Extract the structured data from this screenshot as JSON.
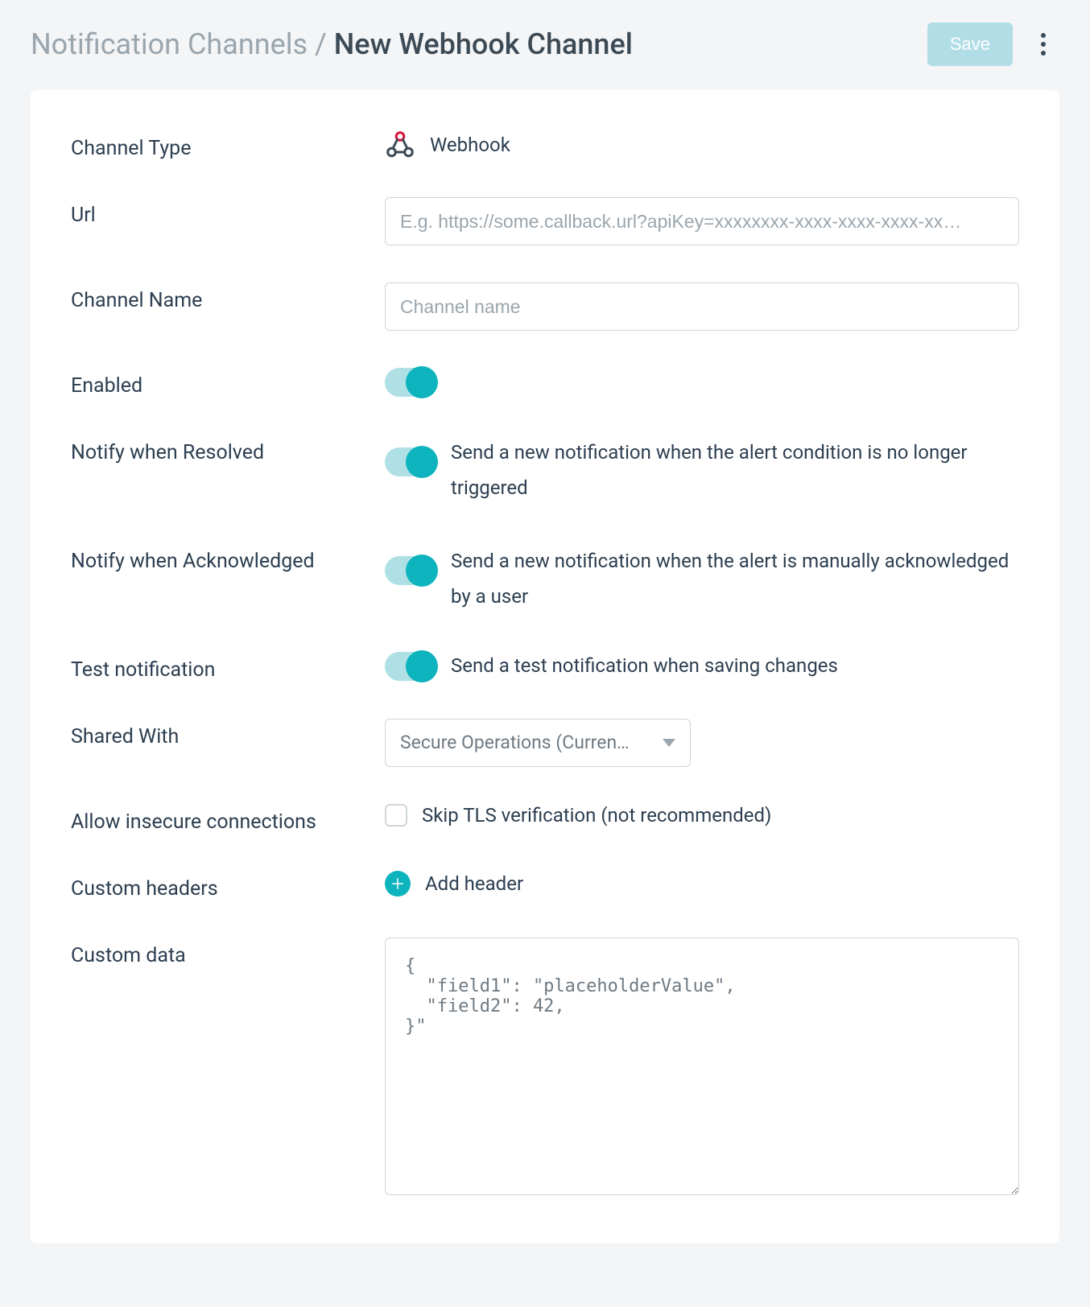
{
  "header": {
    "breadcrumb_parent": "Notification Channels",
    "breadcrumb_sep": " / ",
    "breadcrumb_current": "New Webhook Channel",
    "save_label": "Save"
  },
  "form": {
    "channel_type": {
      "label": "Channel Type",
      "value": "Webhook"
    },
    "url": {
      "label": "Url",
      "placeholder": "E.g. https://some.callback.url?apiKey=xxxxxxxx-xxxx-xxxx-xxxx-xx…",
      "value": ""
    },
    "channel_name": {
      "label": "Channel Name",
      "placeholder": "Channel name",
      "value": ""
    },
    "enabled": {
      "label": "Enabled"
    },
    "notify_resolved": {
      "label": "Notify when Resolved",
      "desc": "Send a new notification when the alert condition is no longer triggered"
    },
    "notify_ack": {
      "label": "Notify when Acknowledged",
      "desc": "Send a new notification when the alert is manually acknowledged by a user"
    },
    "test": {
      "label": "Test notification",
      "desc": "Send a test notification when saving changes"
    },
    "shared_with": {
      "label": "Shared With",
      "selected": "Secure Operations (Curren…"
    },
    "insecure": {
      "label": "Allow insecure connections",
      "desc": "Skip TLS verification (not recommended)"
    },
    "headers": {
      "label": "Custom headers",
      "add_label": "Add header"
    },
    "data": {
      "label": "Custom data",
      "value": "{\n  \"field1\": \"placeholderValue\",\n  \"field2\": 42,\n}\""
    }
  }
}
